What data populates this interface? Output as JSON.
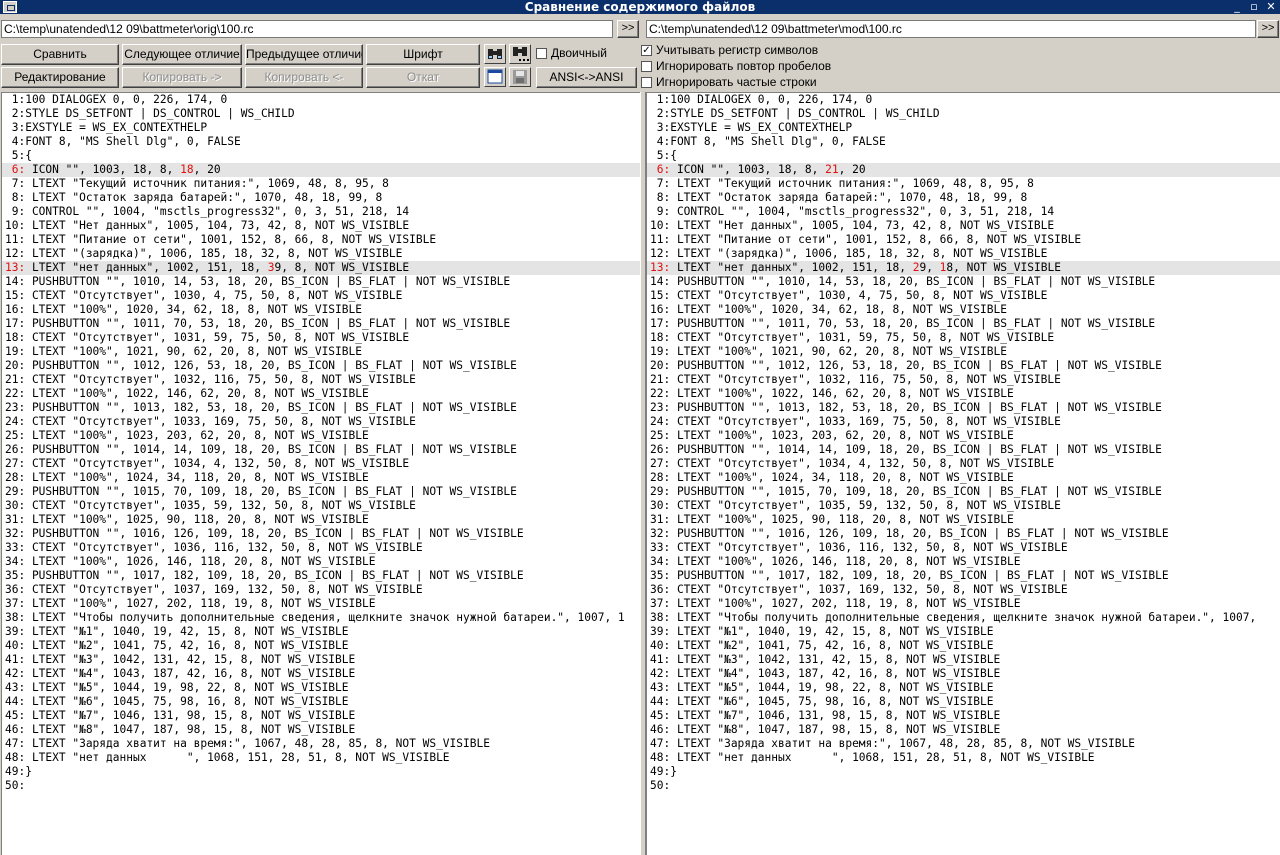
{
  "window": {
    "title": "Сравнение содержимого файлов",
    "controls": [
      "_",
      "▫",
      "✕"
    ]
  },
  "paths": {
    "left": "C:\\temp\\unatended\\12 09\\battmeter\\orig\\100.rc",
    "right": "C:\\temp\\unatended\\12 09\\battmeter\\mod\\100.rc",
    "browse_label": ">>"
  },
  "toolbar": {
    "compare": "Сравнить",
    "next": "Следующее отличие",
    "prev": "Предыдущее отличие",
    "font": "Шрифт",
    "edit": "Редактирование",
    "copy_right": "Копировать ->",
    "copy_left": "Копировать <-",
    "revert": "Откат",
    "ansi": "ANSI<->ANSI",
    "binary": "Двоичный",
    "icons": [
      "find-icon",
      "find-next-icon",
      "window-icon",
      "save-icon"
    ]
  },
  "options": {
    "case": {
      "label": "Учитывать регистр символов",
      "checked": true
    },
    "spaces": {
      "label": "Игнорировать повтор пробелов",
      "checked": false
    },
    "frequent": {
      "label": "Игнорировать частые строки",
      "checked": false
    }
  },
  "left_lines": [
    {
      "text": " 1:100 DIALOGEX 0, 0, 226, 174, 0"
    },
    {
      "text": " 2:STYLE DS_SETFONT | DS_CONTROL | WS_CHILD"
    },
    {
      "text": " 3:EXSTYLE = WS_EX_CONTEXTHELP"
    },
    {
      "text": " 4:FONT 8, \"MS Shell Dlg\", 0, FALSE"
    },
    {
      "text": " 5:{"
    },
    {
      "diff": true,
      "num": " 6:",
      "parts": [
        " ICON \"\", 1003, 18, 8, ",
        {
          "hl": "18"
        },
        ", 20"
      ]
    },
    {
      "text": " 7: LTEXT \"Текущий источник питания:\", 1069, 48, 8, 95, 8"
    },
    {
      "text": " 8: LTEXT \"Остаток заряда батарей:\", 1070, 48, 18, 99, 8"
    },
    {
      "text": " 9: CONTROL \"\", 1004, \"msctls_progress32\", 0, 3, 51, 218, 14"
    },
    {
      "text": "10: LTEXT \"Нет данных\", 1005, 104, 73, 42, 8, NOT WS_VISIBLE"
    },
    {
      "text": "11: LTEXT \"Питание от сети\", 1001, 152, 8, 66, 8, NOT WS_VISIBLE"
    },
    {
      "text": "12: LTEXT \"(зарядка)\", 1006, 185, 18, 32, 8, NOT WS_VISIBLE"
    },
    {
      "diff": true,
      "num": "13:",
      "parts": [
        " LTEXT \"нет данных\", 1002, 151, 18, ",
        {
          "hl": "3"
        },
        "9, 8, NOT WS_VISIBLE"
      ]
    },
    {
      "text": "14: PUSHBUTTON \"\", 1010, 14, 53, 18, 20, BS_ICON | BS_FLAT | NOT WS_VISIBLE"
    },
    {
      "text": "15: CTEXT \"Отсутствует\", 1030, 4, 75, 50, 8, NOT WS_VISIBLE"
    },
    {
      "text": "16: LTEXT \"100%\", 1020, 34, 62, 18, 8, NOT WS_VISIBLE"
    },
    {
      "text": "17: PUSHBUTTON \"\", 1011, 70, 53, 18, 20, BS_ICON | BS_FLAT | NOT WS_VISIBLE"
    },
    {
      "text": "18: CTEXT \"Отсутствует\", 1031, 59, 75, 50, 8, NOT WS_VISIBLE"
    },
    {
      "text": "19: LTEXT \"100%\", 1021, 90, 62, 20, 8, NOT WS_VISIBLE"
    },
    {
      "text": "20: PUSHBUTTON \"\", 1012, 126, 53, 18, 20, BS_ICON | BS_FLAT | NOT WS_VISIBLE"
    },
    {
      "text": "21: CTEXT \"Отсутствует\", 1032, 116, 75, 50, 8, NOT WS_VISIBLE"
    },
    {
      "text": "22: LTEXT \"100%\", 1022, 146, 62, 20, 8, NOT WS_VISIBLE"
    },
    {
      "text": "23: PUSHBUTTON \"\", 1013, 182, 53, 18, 20, BS_ICON | BS_FLAT | NOT WS_VISIBLE"
    },
    {
      "text": "24: CTEXT \"Отсутствует\", 1033, 169, 75, 50, 8, NOT WS_VISIBLE"
    },
    {
      "text": "25: LTEXT \"100%\", 1023, 203, 62, 20, 8, NOT WS_VISIBLE"
    },
    {
      "text": "26: PUSHBUTTON \"\", 1014, 14, 109, 18, 20, BS_ICON | BS_FLAT | NOT WS_VISIBLE"
    },
    {
      "text": "27: CTEXT \"Отсутствует\", 1034, 4, 132, 50, 8, NOT WS_VISIBLE"
    },
    {
      "text": "28: LTEXT \"100%\", 1024, 34, 118, 20, 8, NOT WS_VISIBLE"
    },
    {
      "text": "29: PUSHBUTTON \"\", 1015, 70, 109, 18, 20, BS_ICON | BS_FLAT | NOT WS_VISIBLE"
    },
    {
      "text": "30: CTEXT \"Отсутствует\", 1035, 59, 132, 50, 8, NOT WS_VISIBLE"
    },
    {
      "text": "31: LTEXT \"100%\", 1025, 90, 118, 20, 8, NOT WS_VISIBLE"
    },
    {
      "text": "32: PUSHBUTTON \"\", 1016, 126, 109, 18, 20, BS_ICON | BS_FLAT | NOT WS_VISIBLE"
    },
    {
      "text": "33: CTEXT \"Отсутствует\", 1036, 116, 132, 50, 8, NOT WS_VISIBLE"
    },
    {
      "text": "34: LTEXT \"100%\", 1026, 146, 118, 20, 8, NOT WS_VISIBLE"
    },
    {
      "text": "35: PUSHBUTTON \"\", 1017, 182, 109, 18, 20, BS_ICON | BS_FLAT | NOT WS_VISIBLE"
    },
    {
      "text": "36: CTEXT \"Отсутствует\", 1037, 169, 132, 50, 8, NOT WS_VISIBLE"
    },
    {
      "text": "37: LTEXT \"100%\", 1027, 202, 118, 19, 8, NOT WS_VISIBLE"
    },
    {
      "text": "38: LTEXT \"Чтобы получить дополнительные сведения, щелкните значок нужной батареи.\", 1007, 1"
    },
    {
      "text": "39: LTEXT \"№1\", 1040, 19, 42, 15, 8, NOT WS_VISIBLE"
    },
    {
      "text": "40: LTEXT \"№2\", 1041, 75, 42, 16, 8, NOT WS_VISIBLE"
    },
    {
      "text": "41: LTEXT \"№3\", 1042, 131, 42, 15, 8, NOT WS_VISIBLE"
    },
    {
      "text": "42: LTEXT \"№4\", 1043, 187, 42, 16, 8, NOT WS_VISIBLE"
    },
    {
      "text": "43: LTEXT \"№5\", 1044, 19, 98, 22, 8, NOT WS_VISIBLE"
    },
    {
      "text": "44: LTEXT \"№6\", 1045, 75, 98, 16, 8, NOT WS_VISIBLE"
    },
    {
      "text": "45: LTEXT \"№7\", 1046, 131, 98, 15, 8, NOT WS_VISIBLE"
    },
    {
      "text": "46: LTEXT \"№8\", 1047, 187, 98, 15, 8, NOT WS_VISIBLE"
    },
    {
      "text": "47: LTEXT \"Заряда хватит на время:\", 1067, 48, 28, 85, 8, NOT WS_VISIBLE"
    },
    {
      "text": "48: LTEXT \"нет данных      \", 1068, 151, 28, 51, 8, NOT WS_VISIBLE"
    },
    {
      "text": "49:}"
    },
    {
      "text": "50:"
    }
  ],
  "right_lines": [
    {
      "text": " 1:100 DIALOGEX 0, 0, 226, 174, 0"
    },
    {
      "text": " 2:STYLE DS_SETFONT | DS_CONTROL | WS_CHILD"
    },
    {
      "text": " 3:EXSTYLE = WS_EX_CONTEXTHELP"
    },
    {
      "text": " 4:FONT 8, \"MS Shell Dlg\", 0, FALSE"
    },
    {
      "text": " 5:{"
    },
    {
      "diff": true,
      "num": " 6:",
      "parts": [
        " ICON \"\", 1003, 18, 8, ",
        {
          "hl": "21"
        },
        ", 20"
      ]
    },
    {
      "text": " 7: LTEXT \"Текущий источник питания:\", 1069, 48, 8, 95, 8"
    },
    {
      "text": " 8: LTEXT \"Остаток заряда батарей:\", 1070, 48, 18, 99, 8"
    },
    {
      "text": " 9: CONTROL \"\", 1004, \"msctls_progress32\", 0, 3, 51, 218, 14"
    },
    {
      "text": "10: LTEXT \"Нет данных\", 1005, 104, 73, 42, 8, NOT WS_VISIBLE"
    },
    {
      "text": "11: LTEXT \"Питание от сети\", 1001, 152, 8, 66, 8, NOT WS_VISIBLE"
    },
    {
      "text": "12: LTEXT \"(зарядка)\", 1006, 185, 18, 32, 8, NOT WS_VISIBLE"
    },
    {
      "diff": true,
      "num": "13:",
      "parts": [
        " LTEXT \"нет данных\", 1002, 151, 18, ",
        {
          "hl": "2"
        },
        "9, ",
        {
          "hl": "1"
        },
        "8, NOT WS_VISIBLE"
      ]
    },
    {
      "text": "14: PUSHBUTTON \"\", 1010, 14, 53, 18, 20, BS_ICON | BS_FLAT | NOT WS_VISIBLE"
    },
    {
      "text": "15: CTEXT \"Отсутствует\", 1030, 4, 75, 50, 8, NOT WS_VISIBLE"
    },
    {
      "text": "16: LTEXT \"100%\", 1020, 34, 62, 18, 8, NOT WS_VISIBLE"
    },
    {
      "text": "17: PUSHBUTTON \"\", 1011, 70, 53, 18, 20, BS_ICON | BS_FLAT | NOT WS_VISIBLE"
    },
    {
      "text": "18: CTEXT \"Отсутствует\", 1031, 59, 75, 50, 8, NOT WS_VISIBLE"
    },
    {
      "text": "19: LTEXT \"100%\", 1021, 90, 62, 20, 8, NOT WS_VISIBLE"
    },
    {
      "text": "20: PUSHBUTTON \"\", 1012, 126, 53, 18, 20, BS_ICON | BS_FLAT | NOT WS_VISIBLE"
    },
    {
      "text": "21: CTEXT \"Отсутствует\", 1032, 116, 75, 50, 8, NOT WS_VISIBLE"
    },
    {
      "text": "22: LTEXT \"100%\", 1022, 146, 62, 20, 8, NOT WS_VISIBLE"
    },
    {
      "text": "23: PUSHBUTTON \"\", 1013, 182, 53, 18, 20, BS_ICON | BS_FLAT | NOT WS_VISIBLE"
    },
    {
      "text": "24: CTEXT \"Отсутствует\", 1033, 169, 75, 50, 8, NOT WS_VISIBLE"
    },
    {
      "text": "25: LTEXT \"100%\", 1023, 203, 62, 20, 8, NOT WS_VISIBLE"
    },
    {
      "text": "26: PUSHBUTTON \"\", 1014, 14, 109, 18, 20, BS_ICON | BS_FLAT | NOT WS_VISIBLE"
    },
    {
      "text": "27: CTEXT \"Отсутствует\", 1034, 4, 132, 50, 8, NOT WS_VISIBLE"
    },
    {
      "text": "28: LTEXT \"100%\", 1024, 34, 118, 20, 8, NOT WS_VISIBLE"
    },
    {
      "text": "29: PUSHBUTTON \"\", 1015, 70, 109, 18, 20, BS_ICON | BS_FLAT | NOT WS_VISIBLE"
    },
    {
      "text": "30: CTEXT \"Отсутствует\", 1035, 59, 132, 50, 8, NOT WS_VISIBLE"
    },
    {
      "text": "31: LTEXT \"100%\", 1025, 90, 118, 20, 8, NOT WS_VISIBLE"
    },
    {
      "text": "32: PUSHBUTTON \"\", 1016, 126, 109, 18, 20, BS_ICON | BS_FLAT | NOT WS_VISIBLE"
    },
    {
      "text": "33: CTEXT \"Отсутствует\", 1036, 116, 132, 50, 8, NOT WS_VISIBLE"
    },
    {
      "text": "34: LTEXT \"100%\", 1026, 146, 118, 20, 8, NOT WS_VISIBLE"
    },
    {
      "text": "35: PUSHBUTTON \"\", 1017, 182, 109, 18, 20, BS_ICON | BS_FLAT | NOT WS_VISIBLE"
    },
    {
      "text": "36: CTEXT \"Отсутствует\", 1037, 169, 132, 50, 8, NOT WS_VISIBLE"
    },
    {
      "text": "37: LTEXT \"100%\", 1027, 202, 118, 19, 8, NOT WS_VISIBLE"
    },
    {
      "text": "38: LTEXT \"Чтобы получить дополнительные сведения, щелкните значок нужной батареи.\", 1007,"
    },
    {
      "text": "39: LTEXT \"№1\", 1040, 19, 42, 15, 8, NOT WS_VISIBLE"
    },
    {
      "text": "40: LTEXT \"№2\", 1041, 75, 42, 16, 8, NOT WS_VISIBLE"
    },
    {
      "text": "41: LTEXT \"№3\", 1042, 131, 42, 15, 8, NOT WS_VISIBLE"
    },
    {
      "text": "42: LTEXT \"№4\", 1043, 187, 42, 16, 8, NOT WS_VISIBLE"
    },
    {
      "text": "43: LTEXT \"№5\", 1044, 19, 98, 22, 8, NOT WS_VISIBLE"
    },
    {
      "text": "44: LTEXT \"№6\", 1045, 75, 98, 16, 8, NOT WS_VISIBLE"
    },
    {
      "text": "45: LTEXT \"№7\", 1046, 131, 98, 15, 8, NOT WS_VISIBLE"
    },
    {
      "text": "46: LTEXT \"№8\", 1047, 187, 98, 15, 8, NOT WS_VISIBLE"
    },
    {
      "text": "47: LTEXT \"Заряда хватит на время:\", 1067, 48, 28, 85, 8, NOT WS_VISIBLE"
    },
    {
      "text": "48: LTEXT \"нет данных      \", 1068, 151, 28, 51, 8, NOT WS_VISIBLE"
    },
    {
      "text": "49:}"
    },
    {
      "text": "50:"
    }
  ]
}
